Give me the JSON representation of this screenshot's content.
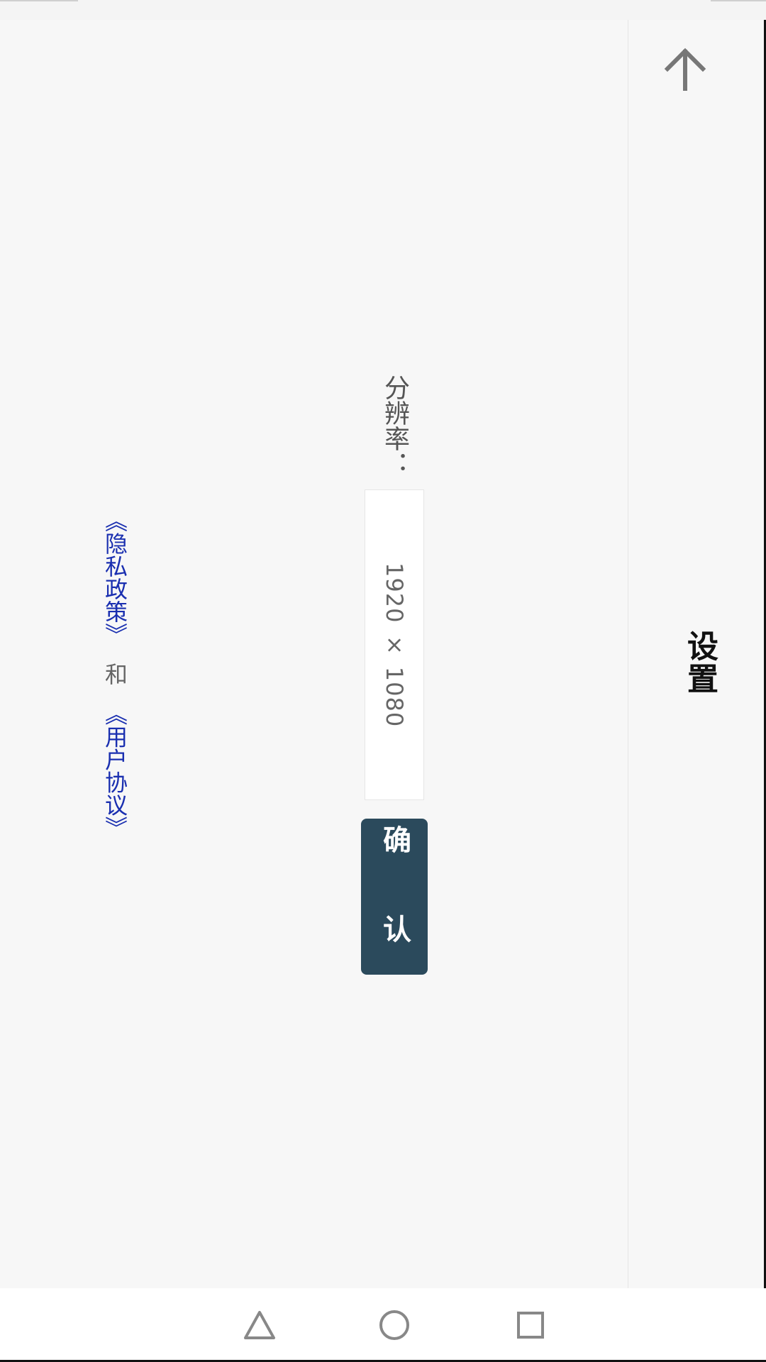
{
  "app_bar": {
    "title": "设置",
    "back_icon": "arrow-up-icon"
  },
  "form": {
    "resolution_label": "分辨率：",
    "resolution_value": "1920 × 1080",
    "confirm_label": "确 认"
  },
  "policy": {
    "privacy_link": "《隐私政策》",
    "and_text": "和",
    "agreement_link": "《用户协议》"
  },
  "nav": {
    "back_icon": "triangle-back-icon",
    "home_icon": "circle-home-icon",
    "recents_icon": "square-recents-icon"
  },
  "colors": {
    "background": "#f7f7f7",
    "accent": "#2b4a5c",
    "link": "#1a2fb0"
  }
}
